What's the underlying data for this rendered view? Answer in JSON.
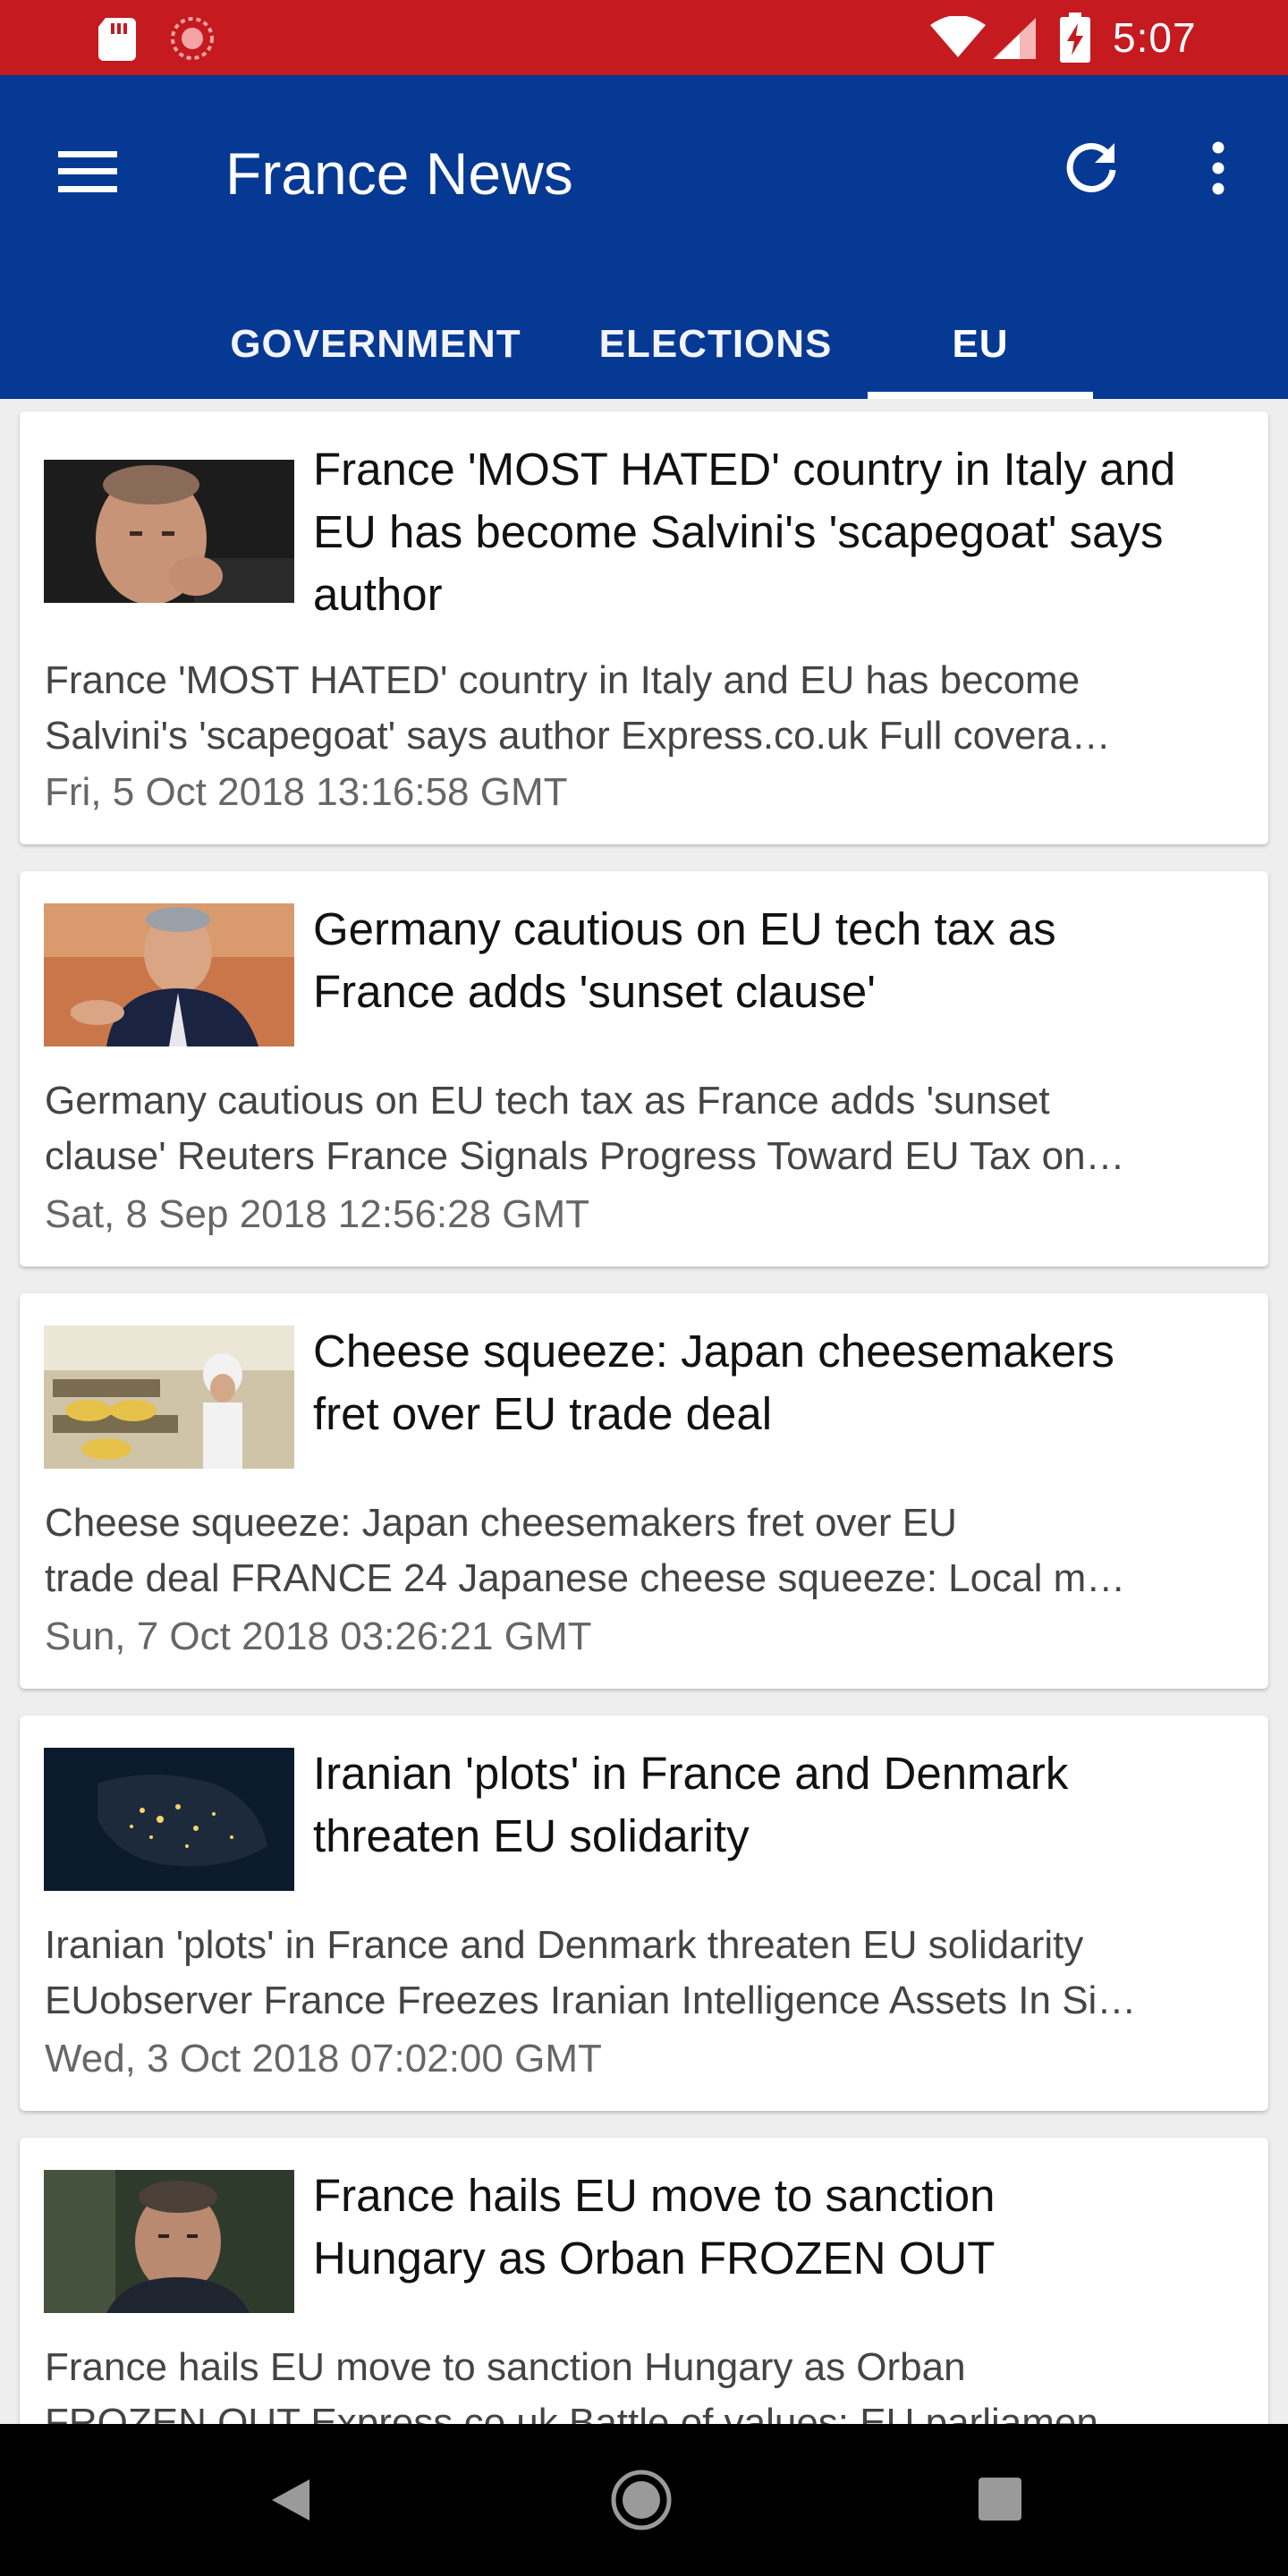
{
  "status_bar": {
    "time": "5:07",
    "icons": [
      "sd-card-icon",
      "sync-icon",
      "wifi-icon",
      "signal-icon",
      "battery-charging-icon"
    ]
  },
  "app_bar": {
    "title": "France News",
    "icons": [
      "menu-icon",
      "refresh-icon",
      "more-vert-icon"
    ]
  },
  "tabs": [
    {
      "label": "GOVERNMENT"
    },
    {
      "label": "ELECTIONS"
    },
    {
      "label": "EU",
      "selected": true
    }
  ],
  "colors": {
    "status_bar": "#c51a20",
    "app_bar": "#053993",
    "background": "#eeeeee",
    "card": "#ffffff"
  },
  "articles": [
    {
      "headline_lines": [
        "France 'MOST HATED' country in Italy and",
        "EU has become Salvini's 'scapegoat' says",
        "author"
      ],
      "summary_lines": [
        "France 'MOST HATED' country in Italy and EU has become",
        "Salvini's 'scapegoat' says author  Express.co.uk  Full covera…"
      ],
      "date": "Fri, 5 Oct 2018 13:16:58 GMT",
      "thumbnail": "man-portrait-photo"
    },
    {
      "headline_lines": [
        "Germany cautious on EU tech tax as",
        "France adds 'sunset clause'"
      ],
      "summary_lines": [
        "Germany cautious on EU tech tax as France adds 'sunset",
        "clause'  Reuters  France Signals Progress Toward EU Tax on…"
      ],
      "date": "Sat, 8 Sep 2018 12:56:28 GMT",
      "thumbnail": "politician-pointing-photo"
    },
    {
      "headline_lines": [
        "Cheese squeeze: Japan cheesemakers",
        "fret over EU trade deal"
      ],
      "summary_lines": [
        "Cheese squeeze: Japan cheesemakers fret over EU",
        "trade deal  FRANCE 24  Japanese cheese squeeze: Local m…"
      ],
      "date": "Sun, 7 Oct 2018 03:26:21 GMT",
      "thumbnail": "cheese-factory-photo"
    },
    {
      "headline_lines": [
        "Iranian 'plots' in France and Denmark",
        "threaten EU solidarity"
      ],
      "summary_lines": [
        "Iranian 'plots' in France and Denmark threaten EU solidarity",
        "EUobserver  France Freezes Iranian Intelligence Assets In Si…"
      ],
      "date": "Wed, 3 Oct 2018 07:02:00 GMT",
      "thumbnail": "europe-night-map-photo"
    },
    {
      "headline_lines": [
        "France hails EU move to sanction",
        "Hungary as Orban FROZEN OUT"
      ],
      "summary_lines": [
        "France hails EU move to sanction Hungary as Orban",
        "FROZEN OUT  Express.co.uk  Battle of values: EU parliamen…"
      ],
      "date": "",
      "thumbnail": "politician-portrait-photo"
    }
  ],
  "nav_bar": {
    "icons": [
      "back-icon",
      "home-icon",
      "recents-icon"
    ]
  }
}
